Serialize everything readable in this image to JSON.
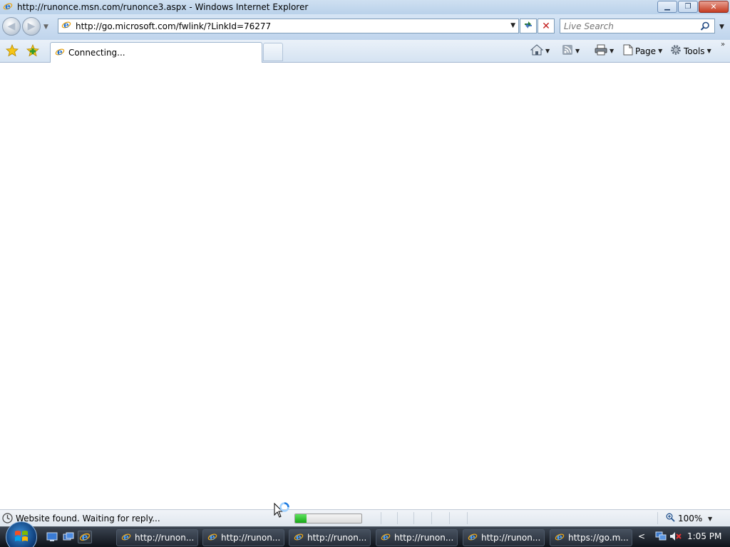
{
  "window": {
    "title": "http://runonce.msn.com/runonce3.aspx - Windows Internet Explorer",
    "controls": {
      "minimize": "▁",
      "restore": "❐",
      "close": "✕"
    }
  },
  "navigation": {
    "back_glyph": "◀",
    "forward_glyph": "▶",
    "dropdown_glyph": "▼",
    "address": "http://go.microsoft.com/fwlink/?LinkId=76277",
    "stop_glyph": "✕",
    "search_placeholder": "Live Search"
  },
  "tabs": [
    {
      "label": "Connecting..."
    }
  ],
  "command_bar": {
    "page_label": "Page",
    "tools_label": "Tools",
    "caret": "▼",
    "chevrons": "»"
  },
  "status": {
    "text": "Website found. Waiting for reply...",
    "progress_fraction": 0.17,
    "zoom": "100%"
  },
  "taskbar": {
    "buttons": [
      {
        "label": "http://runon..."
      },
      {
        "label": "http://runon..."
      },
      {
        "label": "http://runon..."
      },
      {
        "label": "http://runon..."
      },
      {
        "label": "http://runon..."
      },
      {
        "label": "https://go.m..."
      }
    ],
    "tray_arrow": "<",
    "clock": "1:05 PM"
  },
  "colors": {
    "ie_blue": "#1f6fd1",
    "progress_green": "#18a818",
    "stop_red": "#c21b1b"
  }
}
